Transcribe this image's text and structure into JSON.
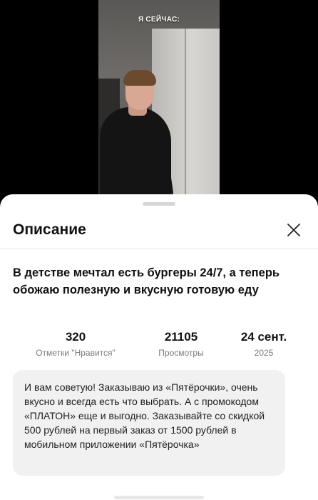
{
  "video": {
    "caption": "Я СЕЙЧАС:"
  },
  "sheet": {
    "title": "Описание",
    "close_icon": "close-icon",
    "headline": "В детстве мечтал есть бургеры 24/7, а теперь обожаю полезную и вкусную готовую еду",
    "stats": [
      {
        "value": "320",
        "label": "Отметки \"Нравится\""
      },
      {
        "value": "21105",
        "label": "Просмотры"
      },
      {
        "value": "24 сент.",
        "label": "2025"
      }
    ],
    "promo": "И вам советую! Заказываю из «Пятёрочки», очень вкусно и всегда есть что выбрать. А с промокодом «ПЛАТОН» еще и выгодно. Заказывайте со скидкой 500 рублей на первый заказ от 1500 рублей в мобильном приложении «Пятёрочка»"
  }
}
